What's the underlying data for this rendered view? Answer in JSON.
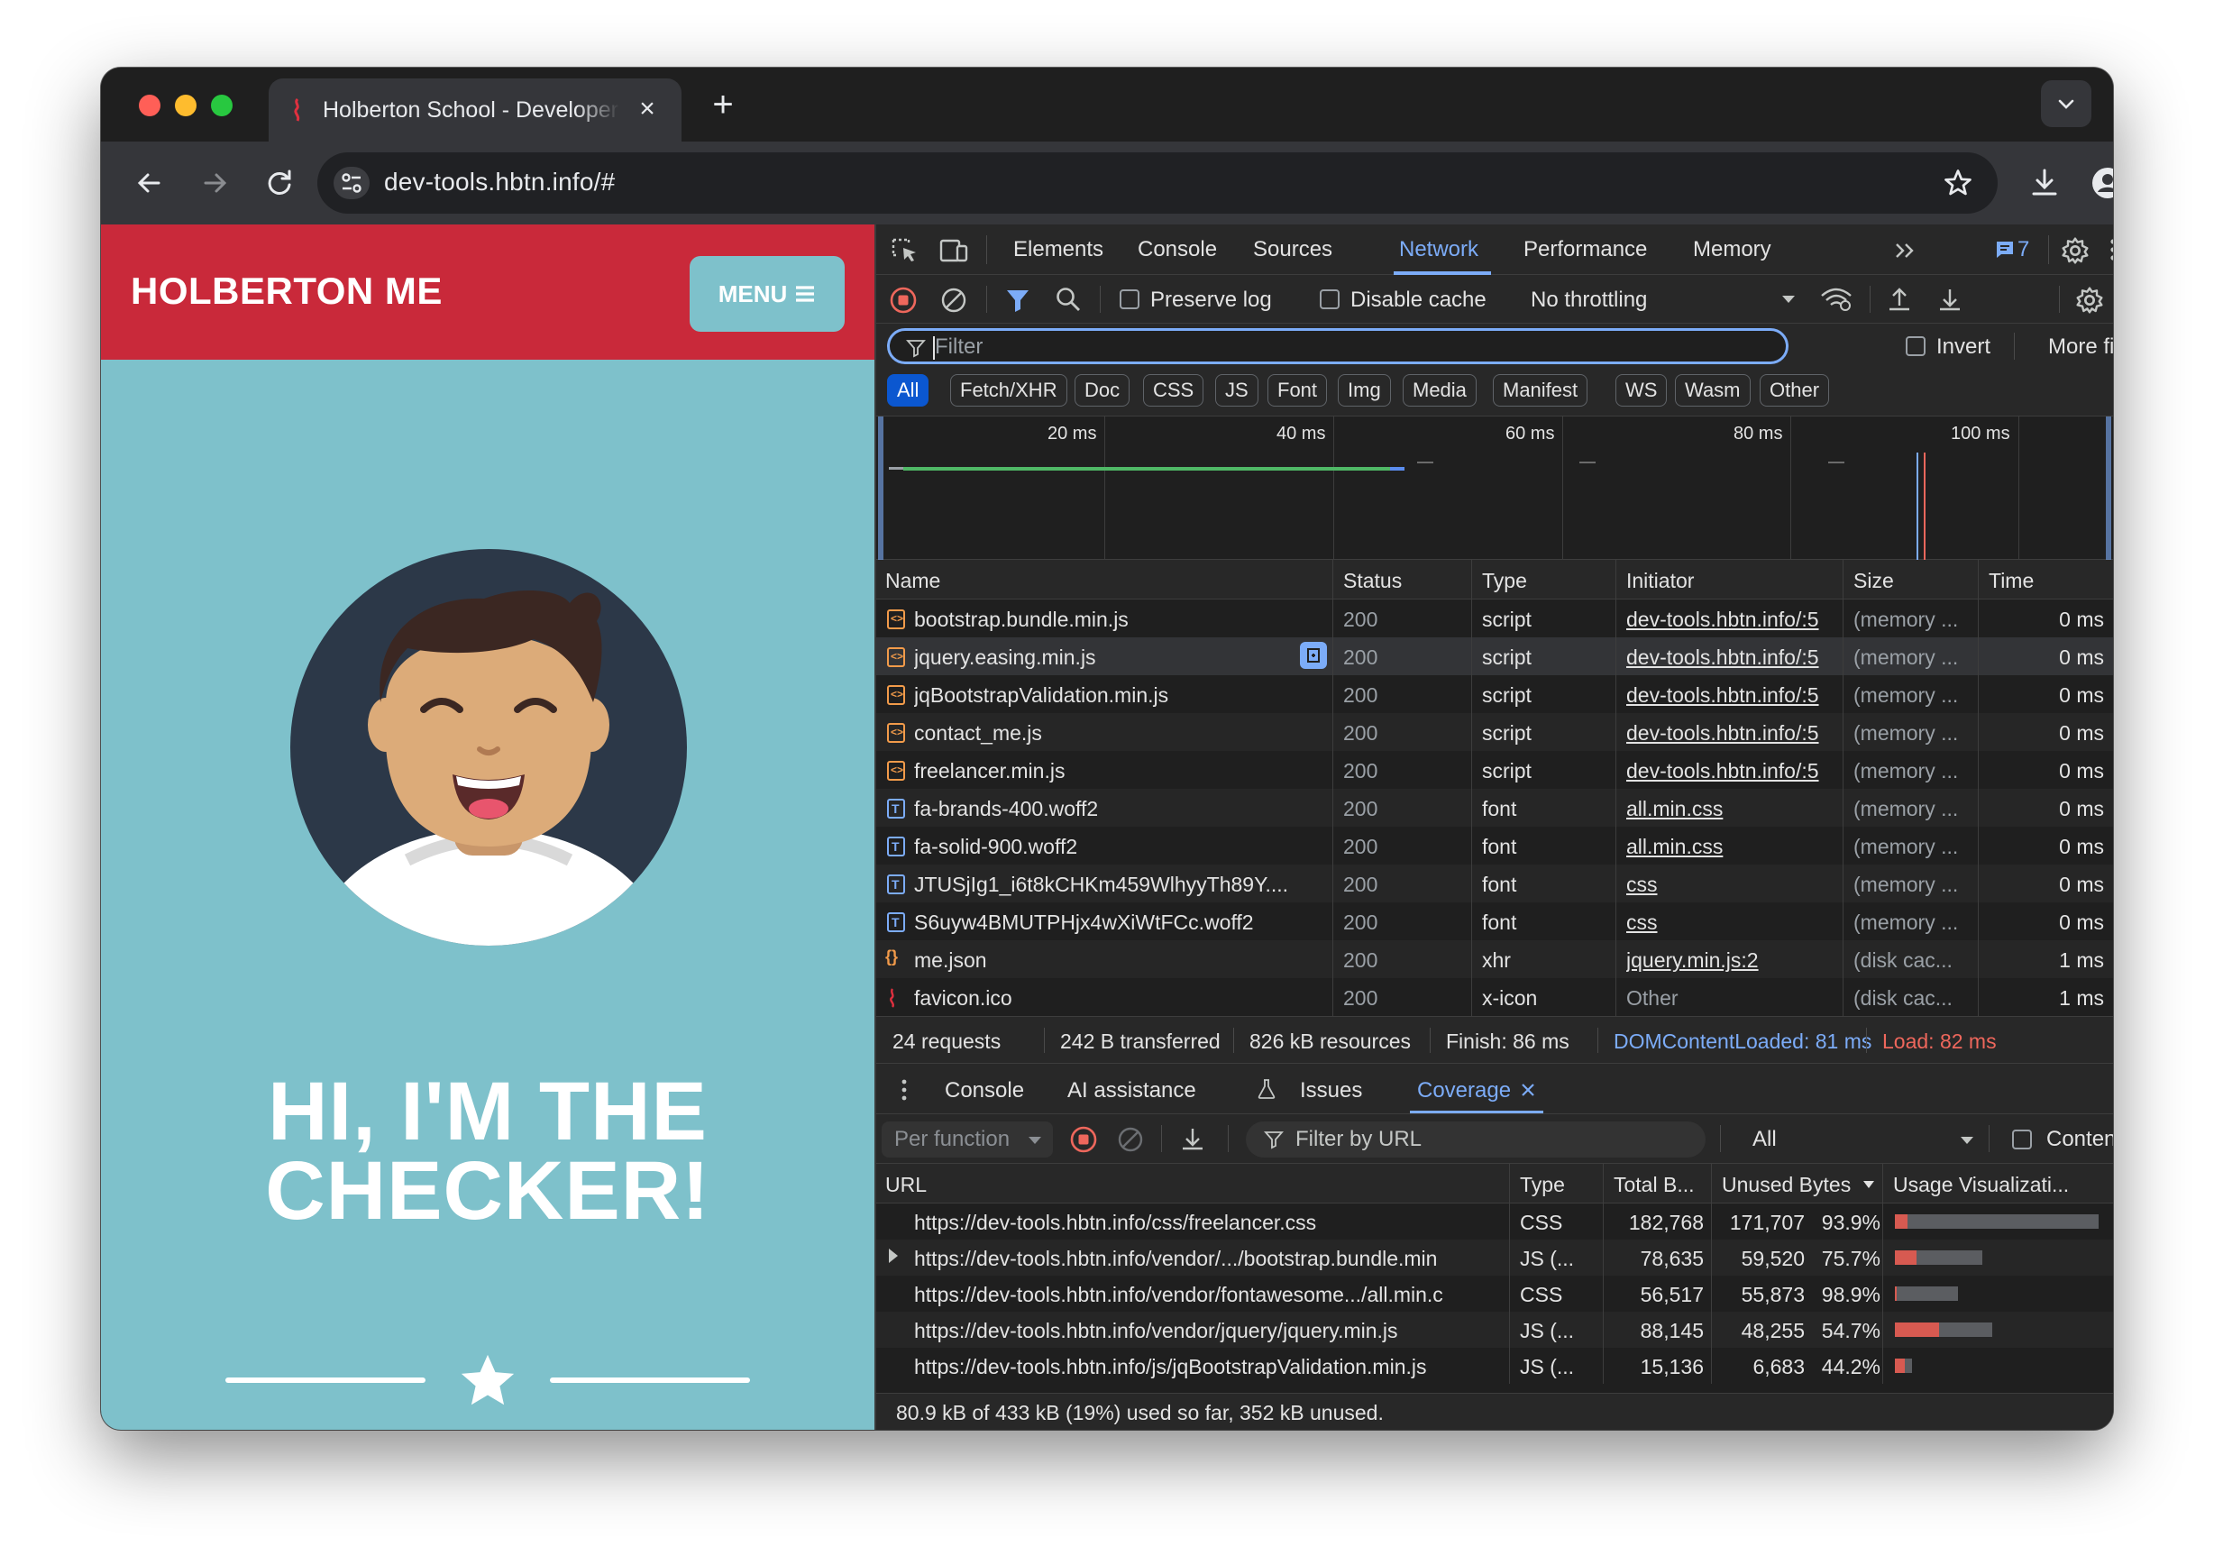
{
  "browser": {
    "tab_title": "Holberton School - Developer",
    "url": "dev-tools.hbtn.info/#"
  },
  "site": {
    "brand": "HOLBERTON ME",
    "menu_label": "MENU",
    "hero_line1": "HI, I'M THE",
    "hero_line2": "CHECKER!"
  },
  "devtools": {
    "tabs": [
      "Elements",
      "Console",
      "Sources",
      "Network",
      "Performance",
      "Memory"
    ],
    "active_tab": "Network",
    "issues_count": "7",
    "toolbar": {
      "preserve_log": "Preserve log",
      "disable_cache": "Disable cache",
      "throttling": "No throttling"
    },
    "filter": {
      "placeholder": "Filter",
      "invert": "Invert",
      "more_filters": "More filters"
    },
    "type_filters": [
      "All",
      "Fetch/XHR",
      "Doc",
      "CSS",
      "JS",
      "Font",
      "Img",
      "Media",
      "Manifest",
      "WS",
      "Wasm",
      "Other"
    ],
    "timeline_labels": [
      "20 ms",
      "40 ms",
      "60 ms",
      "80 ms",
      "100 ms"
    ],
    "columns": [
      "Name",
      "Status",
      "Type",
      "Initiator",
      "Size",
      "Time"
    ],
    "requests": [
      {
        "name": "bootstrap.bundle.min.js",
        "status": "200",
        "type": "script",
        "initiator": "dev-tools.hbtn.info/:5",
        "size": "(memory ...",
        "time": "0 ms",
        "kind": "script"
      },
      {
        "name": "jquery.easing.min.js",
        "status": "200",
        "type": "script",
        "initiator": "dev-tools.hbtn.info/:5",
        "size": "(memory ...",
        "time": "0 ms",
        "kind": "script"
      },
      {
        "name": "jqBootstrapValidation.min.js",
        "status": "200",
        "type": "script",
        "initiator": "dev-tools.hbtn.info/:5",
        "size": "(memory ...",
        "time": "0 ms",
        "kind": "script"
      },
      {
        "name": "contact_me.js",
        "status": "200",
        "type": "script",
        "initiator": "dev-tools.hbtn.info/:5",
        "size": "(memory ...",
        "time": "0 ms",
        "kind": "script"
      },
      {
        "name": "freelancer.min.js",
        "status": "200",
        "type": "script",
        "initiator": "dev-tools.hbtn.info/:5",
        "size": "(memory ...",
        "time": "0 ms",
        "kind": "script"
      },
      {
        "name": "fa-brands-400.woff2",
        "status": "200",
        "type": "font",
        "initiator": "all.min.css",
        "size": "(memory ...",
        "time": "0 ms",
        "kind": "font"
      },
      {
        "name": "fa-solid-900.woff2",
        "status": "200",
        "type": "font",
        "initiator": "all.min.css",
        "size": "(memory ...",
        "time": "0 ms",
        "kind": "font"
      },
      {
        "name": "JTUSjIg1_i6t8kCHKm459WlhyyTh89Y....",
        "status": "200",
        "type": "font",
        "initiator": "css",
        "size": "(memory ...",
        "time": "0 ms",
        "kind": "font"
      },
      {
        "name": "S6uyw4BMUTPHjx4wXiWtFCc.woff2",
        "status": "200",
        "type": "font",
        "initiator": "css",
        "size": "(memory ...",
        "time": "0 ms",
        "kind": "font"
      },
      {
        "name": "me.json",
        "status": "200",
        "type": "xhr",
        "initiator": "jquery.min.js:2",
        "size": "(disk cac...",
        "time": "1 ms",
        "kind": "xhr"
      },
      {
        "name": "favicon.ico",
        "status": "200",
        "type": "x-icon",
        "initiator": "Other",
        "size": "(disk cac...",
        "time": "1 ms",
        "kind": "icon"
      }
    ],
    "summary": {
      "requests": "24 requests",
      "transferred": "242 B transferred",
      "resources": "826 kB resources",
      "finish": "Finish: 86 ms",
      "dcl": "DOMContentLoaded: 81 ms",
      "load": "Load: 82 ms"
    },
    "drawer": {
      "tabs": [
        "Console",
        "AI assistance",
        "Issues",
        "Coverage"
      ],
      "active_tab": "Coverage",
      "per_function": "Per function",
      "filter_placeholder": "Filter by URL",
      "type_select": "All",
      "content_scripts": "Content scripts",
      "columns": [
        "URL",
        "Type",
        "Total B...",
        "Unused Bytes",
        "Usage Visualizati..."
      ],
      "rows": [
        {
          "url": "https://dev-tools.hbtn.info/css/freelancer.css",
          "type": "CSS",
          "total": "182,768",
          "unused": "171,707",
          "pct": "93.9%",
          "used_fraction": 0.061,
          "total_rel": 1.0,
          "expandable": false
        },
        {
          "url": "https://dev-tools.hbtn.info/vendor/.../bootstrap.bundle.min",
          "type": "JS (...",
          "total": "78,635",
          "unused": "59,520",
          "pct": "75.7%",
          "used_fraction": 0.243,
          "total_rel": 0.43,
          "expandable": true
        },
        {
          "url": "https://dev-tools.hbtn.info/vendor/fontawesome.../all.min.c",
          "type": "CSS",
          "total": "56,517",
          "unused": "55,873",
          "pct": "98.9%",
          "used_fraction": 0.011,
          "total_rel": 0.31,
          "expandable": false
        },
        {
          "url": "https://dev-tools.hbtn.info/vendor/jquery/jquery.min.js",
          "type": "JS (...",
          "total": "88,145",
          "unused": "48,255",
          "pct": "54.7%",
          "used_fraction": 0.453,
          "total_rel": 0.48,
          "expandable": false
        },
        {
          "url": "https://dev-tools.hbtn.info/js/jqBootstrapValidation.min.js",
          "type": "JS (...",
          "total": "15,136",
          "unused": "6,683",
          "pct": "44.2%",
          "used_fraction": 0.558,
          "total_rel": 0.083,
          "expandable": false
        }
      ],
      "footer": "80.9 kB of 433 kB (19%) used so far, 352 kB unused."
    }
  },
  "colors": {
    "nav_red": "#c9293a",
    "page_teal": "#7ec1cb",
    "devtools_accent": "#7cacf8",
    "load_red": "#ee675c",
    "usage_used": "#d75a51"
  }
}
